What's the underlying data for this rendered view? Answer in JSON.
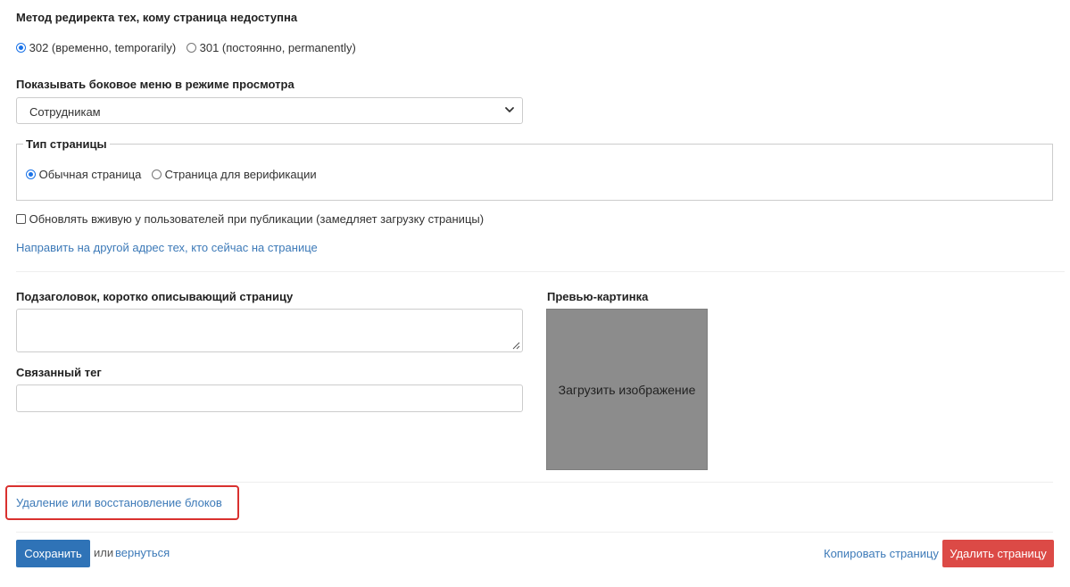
{
  "redirect": {
    "label": "Метод редиректа тех, кому страница недоступна",
    "options": [
      {
        "label": "302 (временно, temporarily)",
        "checked": true
      },
      {
        "label": "301 (постоянно, permanently)",
        "checked": false
      }
    ]
  },
  "side_menu": {
    "label": "Показывать боковое меню в режиме просмотра",
    "selected": "Сотрудникам",
    "icon": "chevron-down-icon"
  },
  "page_type": {
    "legend": "Тип страницы",
    "options": [
      {
        "label": "Обычная страница",
        "checked": true
      },
      {
        "label": "Страница для верификации",
        "checked": false
      }
    ]
  },
  "live_update": {
    "label": "Обновлять вживую у пользователей при публикации (замедляет загрузку страницы)",
    "checked": false
  },
  "redirect_current_link": "Направить на другой адрес тех, кто сейчас на странице",
  "subtitle": {
    "label": "Подзаголовок, коротко описывающий страницу",
    "value": ""
  },
  "related_tag": {
    "label": "Связанный тег",
    "value": ""
  },
  "preview": {
    "label": "Превью-картинка",
    "upload_text": "Загрузить изображение"
  },
  "blocks_link": "Удаление или восстановление блоков",
  "footer": {
    "save_label": "Сохранить",
    "or_text": "или",
    "back_link": "вернуться",
    "copy_link": "Копировать страницу",
    "delete_label": "Удалить страницу"
  },
  "colors": {
    "accent": "#2f73b7",
    "link": "#3d7ab8",
    "danger": "#dc4a46",
    "highlight": "#d9312f",
    "preview_bg": "#8c8c8c"
  }
}
